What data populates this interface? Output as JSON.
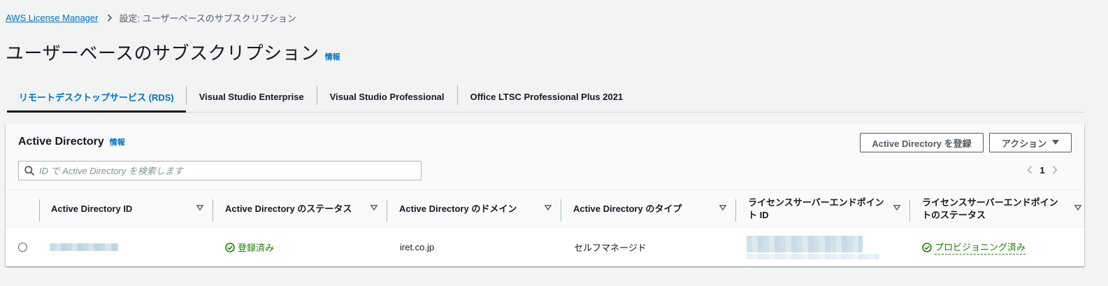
{
  "breadcrumb": {
    "root": "AWS License Manager",
    "current": "設定: ユーザーベースのサブスクリプション"
  },
  "page": {
    "title": "ユーザーベースのサブスクリプション",
    "info": "情報"
  },
  "tabs": [
    {
      "label": "リモートデスクトップサービス (RDS)",
      "active": true
    },
    {
      "label": "Visual Studio Enterprise",
      "active": false
    },
    {
      "label": "Visual Studio Professional",
      "active": false
    },
    {
      "label": "Office LTSC Professional Plus 2021",
      "active": false
    }
  ],
  "panel": {
    "title": "Active Directory",
    "info": "情報",
    "register_button": "Active Directory を登録",
    "actions_button": "アクション",
    "search_placeholder": "ID で Active Directory を検索します",
    "page_number": "1"
  },
  "table": {
    "columns": [
      "Active Directory ID",
      "Active Directory のステータス",
      "Active Directory のドメイン",
      "Active Directory のタイプ",
      "ライセンスサーバーエンドポイント ID",
      "ライセンスサーバーエンドポイントのステータス"
    ],
    "rows": [
      {
        "status": "登録済み",
        "domain": "iret.co.jp",
        "type": "セルフマネージド",
        "endpoint_status": "プロビジョニング済み"
      }
    ]
  },
  "colors": {
    "link": "#0073bb",
    "success": "#1d8102",
    "text": "#16191f",
    "background": "#f2f3f3"
  },
  "icons": [
    "chevron-right-icon",
    "search-icon",
    "caret-down-icon",
    "sort-icon",
    "chevron-left-icon",
    "check-circle-icon"
  ]
}
